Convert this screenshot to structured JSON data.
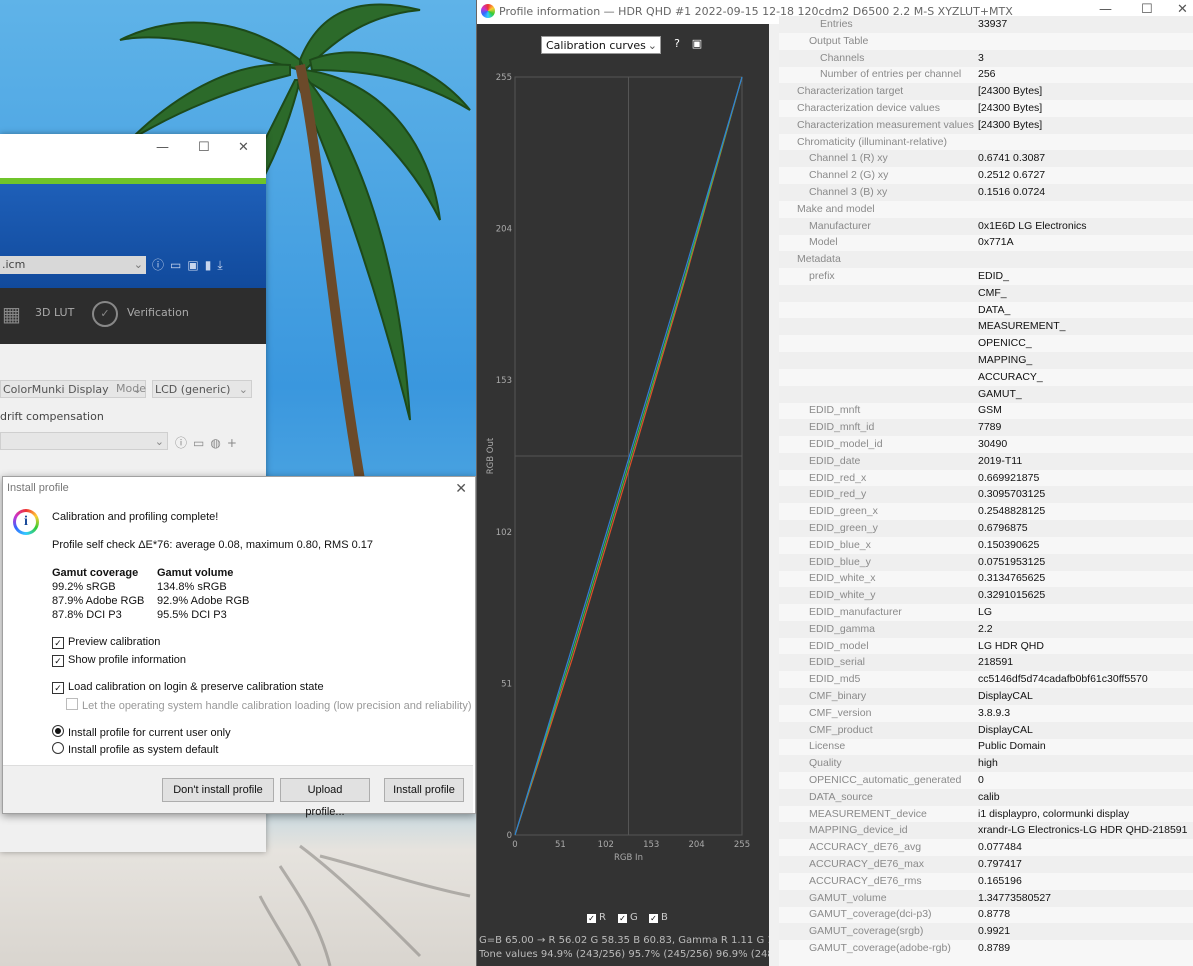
{
  "main_window": {
    "profile_field": ".icm",
    "tabs": [
      "3D LUT",
      "Verification"
    ],
    "instrument": "ColorMunki Display",
    "mode_label": "Mode",
    "mode_value": "LCD (generic)",
    "drift_label": "drift compensation"
  },
  "dialog": {
    "title": "Install profile",
    "heading": "Calibration and profiling complete!",
    "self_check": "Profile self check ΔE*76: average 0.08, maximum 0.80, RMS 0.17",
    "coverage_header": "Gamut coverage",
    "volume_header": "Gamut volume",
    "coverage": [
      "99.2% sRGB",
      "87.9% Adobe RGB",
      "87.8% DCI P3"
    ],
    "volume": [
      "134.8% sRGB",
      "92.9% Adobe RGB",
      "95.5% DCI P3"
    ],
    "preview_calibration": "Preview calibration",
    "show_profile_info": "Show profile information",
    "load_calibration": "Load calibration on login & preserve calibration state",
    "os_handle": "Let the operating system handle calibration loading (low precision and reliability)",
    "install_current_user": "Install profile for current user only",
    "install_system_default": "Install profile as system default",
    "buttons": {
      "dont_install": "Don't install profile",
      "upload": "Upload profile...",
      "install": "Install profile"
    }
  },
  "profile_window": {
    "title": "Profile information — HDR QHD #1 2022-09-15 12-18 120cdm2 D6500 2.2 M-S XYZLUT+MTX",
    "chart_select": "Calibration curves",
    "status_line1": "G=B 65.00 → R 56.02 G 58.35 B 60.83, Gamma R 1.11 G 1.08 B 1.",
    "status_line2": "Tone values 94.9% (243/256) 95.7% (245/256) 96.9% (248/256)",
    "legend": [
      "R",
      "G",
      "B"
    ]
  },
  "chart_data": {
    "type": "line",
    "xlabel": "RGB In",
    "ylabel": "RGB Out",
    "xlim": [
      0,
      255
    ],
    "ylim": [
      0,
      255
    ],
    "x_ticks": [
      0,
      51,
      102,
      153,
      204,
      255
    ],
    "y_ticks": [
      0,
      51,
      102,
      153,
      204,
      255
    ],
    "series": [
      {
        "name": "R",
        "color": "#e0502a",
        "x": [
          0,
          64,
          128,
          192,
          255
        ],
        "y": [
          0,
          59,
          123,
          188,
          255
        ]
      },
      {
        "name": "G",
        "color": "#3cb84a",
        "x": [
          0,
          64,
          128,
          192,
          255
        ],
        "y": [
          0,
          61,
          125,
          189,
          255
        ]
      },
      {
        "name": "B",
        "color": "#2f7fd8",
        "x": [
          0,
          64,
          128,
          192,
          255
        ],
        "y": [
          0,
          63,
          127,
          191,
          255
        ]
      }
    ]
  },
  "tree": [
    {
      "k": "Entries",
      "v": "33937",
      "lvl": 2
    },
    {
      "k": "Output Table",
      "v": "",
      "lvl": 1
    },
    {
      "k": "Channels",
      "v": "3",
      "lvl": 2
    },
    {
      "k": "Number of entries per channel",
      "v": "256",
      "lvl": 2
    },
    {
      "k": "Characterization target",
      "v": "[24300 Bytes]",
      "lvl": 0
    },
    {
      "k": "Characterization device values",
      "v": "[24300 Bytes]",
      "lvl": 0
    },
    {
      "k": "Characterization measurement values",
      "v": "[24300 Bytes]",
      "lvl": 0
    },
    {
      "k": "Chromaticity (illuminant-relative)",
      "v": "",
      "lvl": 0
    },
    {
      "k": "Channel 1 (R) xy",
      "v": "0.6741 0.3087",
      "lvl": 1
    },
    {
      "k": "Channel 2 (G) xy",
      "v": "0.2512 0.6727",
      "lvl": 1
    },
    {
      "k": "Channel 3 (B) xy",
      "v": "0.1516 0.0724",
      "lvl": 1
    },
    {
      "k": "Make and model",
      "v": "",
      "lvl": 0
    },
    {
      "k": "Manufacturer",
      "v": "0x1E6D LG Electronics",
      "lvl": 1
    },
    {
      "k": "Model",
      "v": "0x771A",
      "lvl": 1
    },
    {
      "k": "Metadata",
      "v": "",
      "lvl": 0
    },
    {
      "k": "prefix",
      "v": "EDID_",
      "lvl": 1
    },
    {
      "k": "",
      "v": "CMF_",
      "lvl": 1
    },
    {
      "k": "",
      "v": "DATA_",
      "lvl": 1
    },
    {
      "k": "",
      "v": "MEASUREMENT_",
      "lvl": 1
    },
    {
      "k": "",
      "v": "OPENICC_",
      "lvl": 1
    },
    {
      "k": "",
      "v": "MAPPING_",
      "lvl": 1
    },
    {
      "k": "",
      "v": "ACCURACY_",
      "lvl": 1
    },
    {
      "k": "",
      "v": "GAMUT_",
      "lvl": 1
    },
    {
      "k": "EDID_mnft",
      "v": "GSM",
      "lvl": 1
    },
    {
      "k": "EDID_mnft_id",
      "v": "7789",
      "lvl": 1
    },
    {
      "k": "EDID_model_id",
      "v": "30490",
      "lvl": 1
    },
    {
      "k": "EDID_date",
      "v": "2019-T11",
      "lvl": 1
    },
    {
      "k": "EDID_red_x",
      "v": "0.669921875",
      "lvl": 1
    },
    {
      "k": "EDID_red_y",
      "v": "0.3095703125",
      "lvl": 1
    },
    {
      "k": "EDID_green_x",
      "v": "0.2548828125",
      "lvl": 1
    },
    {
      "k": "EDID_green_y",
      "v": "0.6796875",
      "lvl": 1
    },
    {
      "k": "EDID_blue_x",
      "v": "0.150390625",
      "lvl": 1
    },
    {
      "k": "EDID_blue_y",
      "v": "0.0751953125",
      "lvl": 1
    },
    {
      "k": "EDID_white_x",
      "v": "0.3134765625",
      "lvl": 1
    },
    {
      "k": "EDID_white_y",
      "v": "0.3291015625",
      "lvl": 1
    },
    {
      "k": "EDID_manufacturer",
      "v": "LG",
      "lvl": 1
    },
    {
      "k": "EDID_gamma",
      "v": "2.2",
      "lvl": 1
    },
    {
      "k": "EDID_model",
      "v": "LG HDR QHD",
      "lvl": 1
    },
    {
      "k": "EDID_serial",
      "v": "218591",
      "lvl": 1
    },
    {
      "k": "EDID_md5",
      "v": "cc5146df5d74cadafb0bf61c30ff5570",
      "lvl": 1
    },
    {
      "k": "CMF_binary",
      "v": "DisplayCAL",
      "lvl": 1
    },
    {
      "k": "CMF_version",
      "v": "3.8.9.3",
      "lvl": 1
    },
    {
      "k": "CMF_product",
      "v": "DisplayCAL",
      "lvl": 1
    },
    {
      "k": "License",
      "v": "Public Domain",
      "lvl": 1
    },
    {
      "k": "Quality",
      "v": "high",
      "lvl": 1
    },
    {
      "k": "OPENICC_automatic_generated",
      "v": "0",
      "lvl": 1
    },
    {
      "k": "DATA_source",
      "v": "calib",
      "lvl": 1
    },
    {
      "k": "MEASUREMENT_device",
      "v": "i1 displaypro, colormunki display",
      "lvl": 1
    },
    {
      "k": "MAPPING_device_id",
      "v": "xrandr-LG Electronics-LG HDR QHD-218591",
      "lvl": 1
    },
    {
      "k": "ACCURACY_dE76_avg",
      "v": "0.077484",
      "lvl": 1
    },
    {
      "k": "ACCURACY_dE76_max",
      "v": "0.797417",
      "lvl": 1
    },
    {
      "k": "ACCURACY_dE76_rms",
      "v": "0.165196",
      "lvl": 1
    },
    {
      "k": "GAMUT_volume",
      "v": "1.34773580527",
      "lvl": 1
    },
    {
      "k": "GAMUT_coverage(dci-p3)",
      "v": "0.8778",
      "lvl": 1
    },
    {
      "k": "GAMUT_coverage(srgb)",
      "v": "0.9921",
      "lvl": 1
    },
    {
      "k": "GAMUT_coverage(adobe-rgb)",
      "v": "0.8789",
      "lvl": 1
    }
  ]
}
